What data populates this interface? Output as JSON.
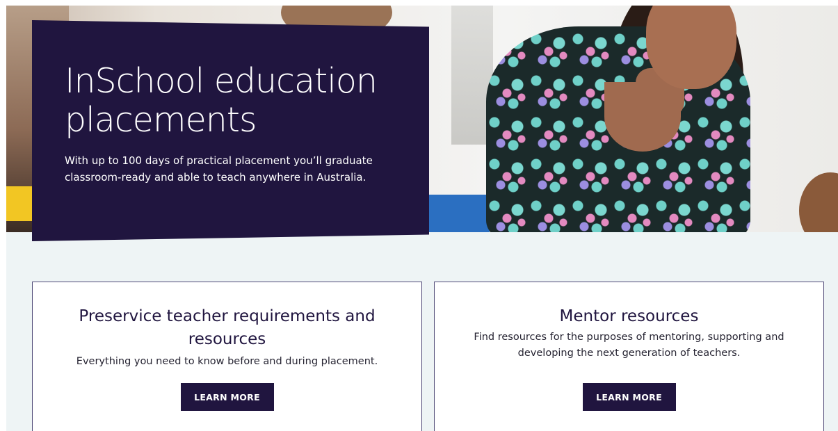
{
  "hero": {
    "title": "InSchool education placements",
    "subtitle": "With up to 100 days of practical placement you’ll graduate classroom-ready and able to teach anywhere in Australia."
  },
  "cards": [
    {
      "title": "Preservice teacher requirements and resources",
      "text": "Everything you need to know before and during placement.",
      "button_label": "LEARN MORE"
    },
    {
      "title": "Mentor resources",
      "text": "Find resources for the purposes of mentoring, supporting and developing the next generation of teachers.",
      "button_label": "LEARN MORE"
    }
  ],
  "colors": {
    "brand_purple": "#20153f",
    "page_background": "#eef4f5",
    "card_border": "#4e4876"
  }
}
